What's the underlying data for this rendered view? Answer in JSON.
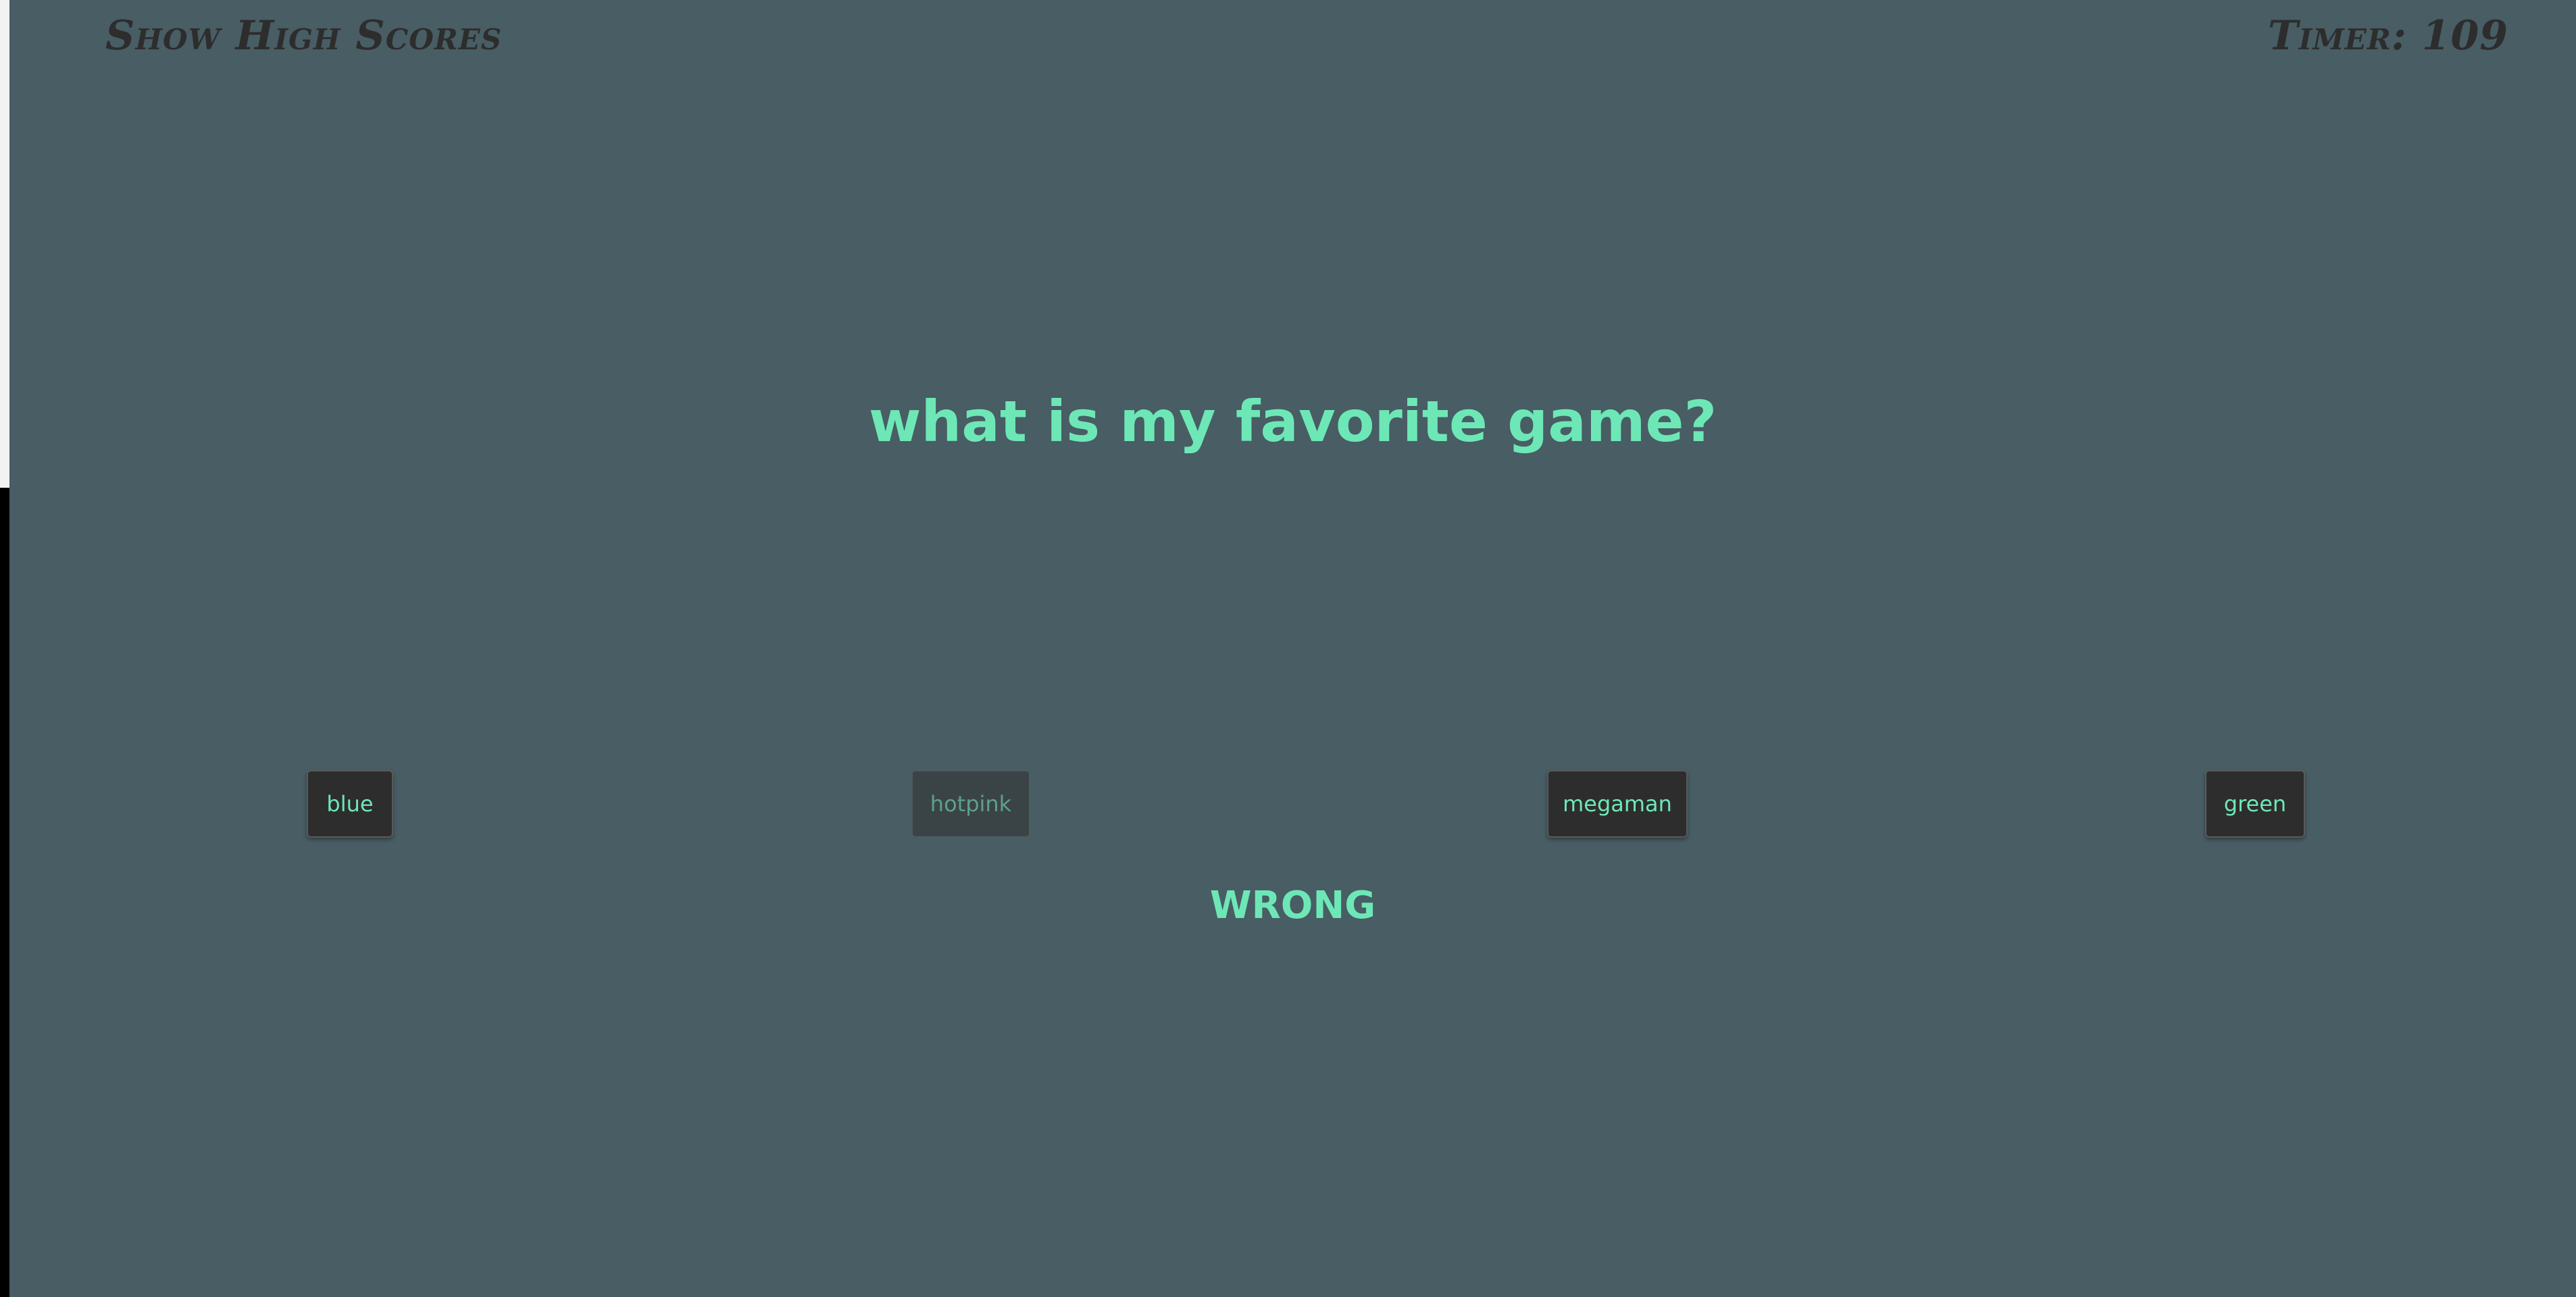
{
  "header": {
    "high_scores_label": "Show High Scores",
    "timer_label": "Timer: 109"
  },
  "quiz": {
    "question": "what is my favorite game?",
    "choices": [
      {
        "label": "blue",
        "disabled": false
      },
      {
        "label": "hotpink",
        "disabled": true
      },
      {
        "label": "megaman",
        "disabled": false
      },
      {
        "label": "green",
        "disabled": false
      }
    ],
    "result": "WRONG"
  },
  "colors": {
    "background": "#485d64",
    "accent": "#6ee7b7",
    "header_text": "#2d2d2d",
    "button_bg": "#2d2d2d"
  }
}
